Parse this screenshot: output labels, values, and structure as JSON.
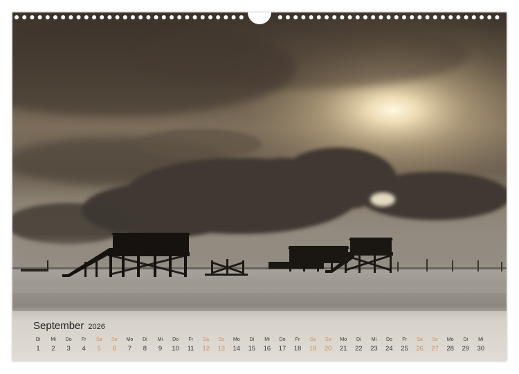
{
  "calendar": {
    "month": "September",
    "year": "2026",
    "days": [
      {
        "weekday": "Di",
        "day": "1",
        "weekend": false
      },
      {
        "weekday": "Mi",
        "day": "2",
        "weekend": false
      },
      {
        "weekday": "Do",
        "day": "3",
        "weekend": false
      },
      {
        "weekday": "Fr",
        "day": "4",
        "weekend": false
      },
      {
        "weekday": "Sa",
        "day": "5",
        "weekend": true
      },
      {
        "weekday": "So",
        "day": "6",
        "weekend": true
      },
      {
        "weekday": "Mo",
        "day": "7",
        "weekend": false
      },
      {
        "weekday": "Di",
        "day": "8",
        "weekend": false
      },
      {
        "weekday": "Mi",
        "day": "9",
        "weekend": false
      },
      {
        "weekday": "Do",
        "day": "10",
        "weekend": false
      },
      {
        "weekday": "Fr",
        "day": "11",
        "weekend": false
      },
      {
        "weekday": "Sa",
        "day": "12",
        "weekend": true
      },
      {
        "weekday": "So",
        "day": "13",
        "weekend": true
      },
      {
        "weekday": "Mo",
        "day": "14",
        "weekend": false
      },
      {
        "weekday": "Di",
        "day": "15",
        "weekend": false
      },
      {
        "weekday": "Mi",
        "day": "16",
        "weekend": false
      },
      {
        "weekday": "Do",
        "day": "17",
        "weekend": false
      },
      {
        "weekday": "Fr",
        "day": "18",
        "weekend": false
      },
      {
        "weekday": "Sa",
        "day": "19",
        "weekend": true
      },
      {
        "weekday": "So",
        "day": "20",
        "weekend": true
      },
      {
        "weekday": "Mo",
        "day": "21",
        "weekend": false
      },
      {
        "weekday": "Di",
        "day": "22",
        "weekend": false
      },
      {
        "weekday": "Mi",
        "day": "23",
        "weekend": false
      },
      {
        "weekday": "Do",
        "day": "24",
        "weekend": false
      },
      {
        "weekday": "Fr",
        "day": "25",
        "weekend": false
      },
      {
        "weekday": "Sa",
        "day": "26",
        "weekend": true
      },
      {
        "weekday": "So",
        "day": "27",
        "weekend": true
      },
      {
        "weekday": "Mo",
        "day": "28",
        "weekend": false
      },
      {
        "weekday": "Di",
        "day": "29",
        "weekend": false
      },
      {
        "weekday": "Mi",
        "day": "30",
        "weekend": false
      }
    ]
  },
  "colors": {
    "weekend": "#d28a57",
    "text": "#222222",
    "sky_dark": "#3a3128",
    "sky_light": "#fbf2da"
  }
}
